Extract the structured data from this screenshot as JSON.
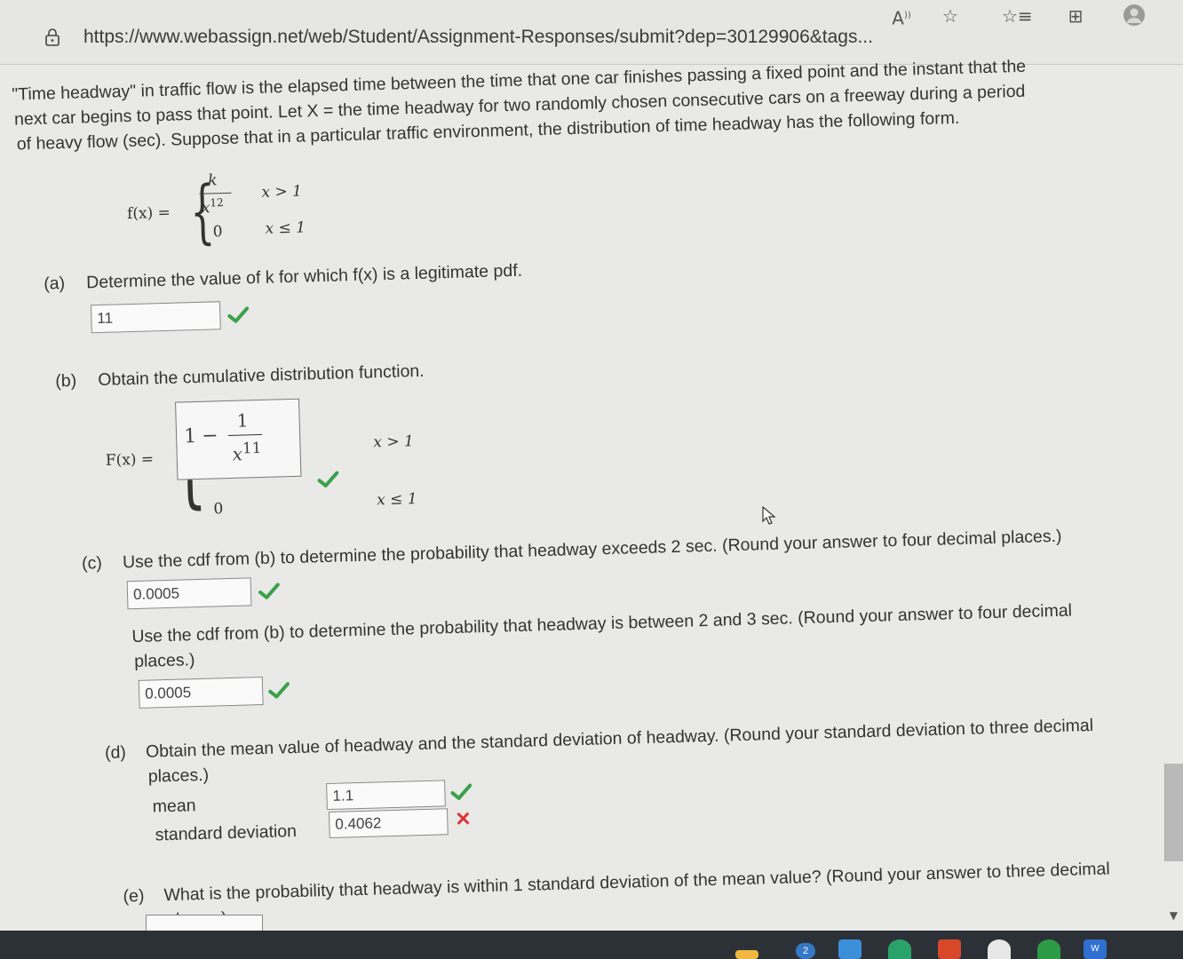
{
  "browser": {
    "url": "https://www.webassign.net/web/Student/Assignment-Responses/submit?dep=30129906&tags...",
    "read_aloud_label": "A",
    "icons": [
      "lock-icon",
      "read-aloud-icon",
      "add-favorite-icon",
      "favorites-icon",
      "collections-icon",
      "profile-icon"
    ]
  },
  "problem": {
    "intro_line1": "\"Time headway\" in traffic flow is the elapsed time between the time that one car finishes passing a fixed point and the instant that the",
    "intro_line2": "next car begins to pass that point. Let X = the time headway for two randomly chosen consecutive cars on a freeway during a period",
    "intro_line3": "of heavy flow (sec). Suppose that in a particular traffic environment, the distribution of time headway has the following form.",
    "pdf": {
      "lhs": "f(x) =",
      "numerator": "k",
      "denominator_base": "x",
      "denominator_exp": "12",
      "cond1": "x > 1",
      "zero": "0",
      "cond2": "x ≤ 1"
    }
  },
  "part_a": {
    "label": "(a)",
    "question": "Determine the value of k for which f(x) is a legitimate pdf.",
    "answer": "11",
    "status": "correct"
  },
  "part_b": {
    "label": "(b)",
    "question": "Obtain the cumulative distribution function.",
    "lhs": "F(x) =",
    "answer_one": "1",
    "answer_minus": "−",
    "answer_num": "1",
    "answer_base": "x",
    "answer_exp": "11",
    "cond1": "x > 1",
    "zero": "0",
    "cond2": "x ≤ 1",
    "status": "correct"
  },
  "part_c": {
    "label": "(c)",
    "question1": "Use the cdf from (b) to determine the probability that headway exceeds 2 sec. (Round your answer to four decimal places.)",
    "answer1": "0.0005",
    "status1": "correct",
    "question2_line1": "Use the cdf from (b) to determine the probability that headway is between 2 and 3 sec. (Round your answer to four decimal",
    "question2_line2": "places.)",
    "answer2": "0.0005",
    "status2": "correct"
  },
  "part_d": {
    "label": "(d)",
    "question_line1": "Obtain the mean value of headway and the standard deviation of headway. (Round your standard deviation to three decimal",
    "question_line2": "places.)",
    "mean_label": "mean",
    "mean_answer": "1.1",
    "mean_status": "correct",
    "sd_label": "standard deviation",
    "sd_answer": "0.4062",
    "sd_status": "incorrect"
  },
  "part_e": {
    "label": "(e)",
    "question_line1": "What is the probability that headway is within 1 standard deviation of the mean value? (Round your answer to three decimal",
    "question_line2": "places.)",
    "answer": ""
  },
  "taskbar": {
    "badge": "2",
    "apps": [
      "file-explorer-icon",
      "mail-icon",
      "edge-icon",
      "office-icon",
      "chrome-icon",
      "xbox-icon",
      "word-icon"
    ]
  },
  "colors": {
    "check": "#3aa14a",
    "cross": "#d33333",
    "page_bg": "#e9e9e7",
    "taskbar": "#2c3138"
  }
}
